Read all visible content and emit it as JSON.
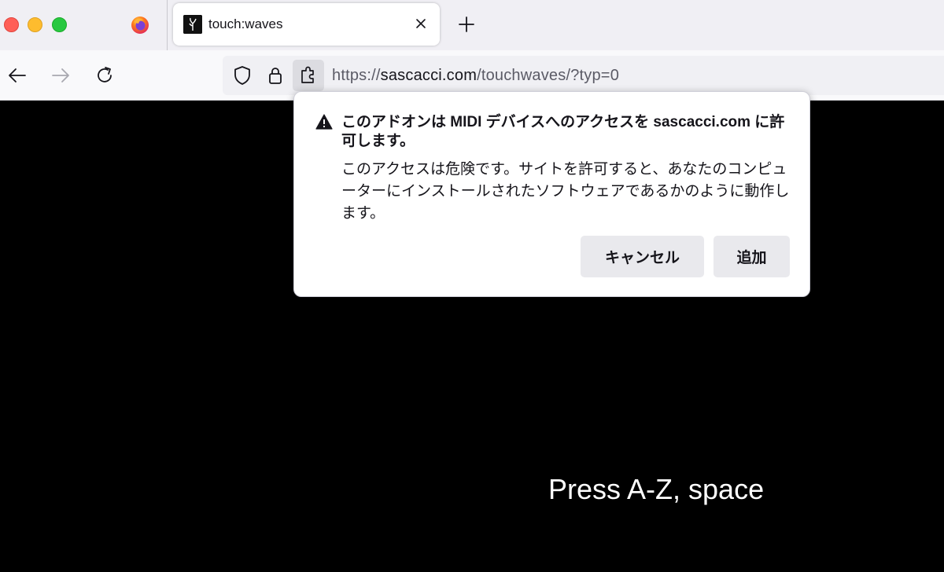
{
  "tab": {
    "title": "touch:waves"
  },
  "urlbar": {
    "url_prefix": "https://",
    "url_domain": "sascacci.com",
    "url_path": "/touchwaves/?typ=0"
  },
  "panel": {
    "title": "このアドオンは MIDI デバイスへのアクセスを sascacci.com に許可します。",
    "body": "このアクセスは危険です。サイトを許可すると、あなたのコンピューターにインストールされたソフトウェアであるかのように動作します。",
    "cancel_label": "キャンセル",
    "add_label": "追加"
  },
  "content": {
    "prompt": "Press A-Z, space"
  },
  "colors": {
    "page_background": "#000000",
    "tabstrip_background": "#f0eff4",
    "button_background": "#e9e9ed"
  },
  "icons": [
    "firefox-icon",
    "favicon-icon",
    "close-icon",
    "plus-icon",
    "back-icon",
    "forward-icon",
    "reload-icon",
    "shield-icon",
    "lock-icon",
    "extension-icon",
    "warning-icon"
  ]
}
